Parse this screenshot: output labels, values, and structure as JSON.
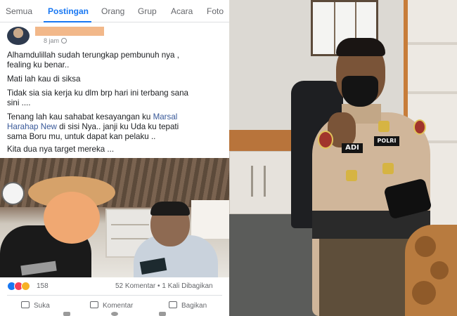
{
  "tabs": [
    {
      "label": "Semua",
      "active": false
    },
    {
      "label": "Postingan",
      "active": true
    },
    {
      "label": "Orang",
      "active": false
    },
    {
      "label": "Grup",
      "active": false
    },
    {
      "label": "Acara",
      "active": false
    },
    {
      "label": "Foto",
      "active": false
    }
  ],
  "post": {
    "time": "8 jam",
    "paragraphs": [
      "Alhamdulillah sudah terungkap pembunuh nya ,\nfealing ku benar..",
      "Mati lah kau di siksa",
      "Tidak sia sia kerja ku dlm brp hari ini terbang sana\nsini ....",
      "Kita dua nya target mereka ..."
    ],
    "tag_pre": "Tenang lah kau sahabat kesayangan ku ",
    "tag_link": "Marsal\nHarahap New",
    "tag_post": "  di sisi Nya.. janji ku Uda ku tepati\nsama Boru mu, untuk  dapat kan pelaku .."
  },
  "engagement": {
    "reaction_count": "158",
    "stats": "52 Komentar • 1 Kali Dibagikan"
  },
  "actions": {
    "like": "Suka",
    "comment": "Komentar",
    "share": "Bagikan"
  },
  "photo_text": {
    "name_tag": "ADI",
    "polri_tag": "POLRI"
  },
  "colors": {
    "fb_blue": "#1877f2",
    "link": "#385898",
    "text": "#1c1e21",
    "muted": "#65676b"
  }
}
